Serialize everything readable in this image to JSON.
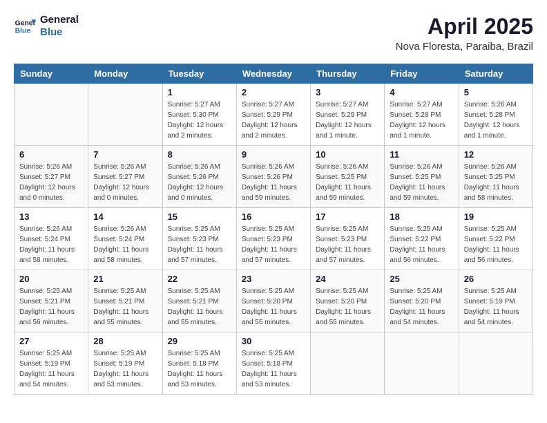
{
  "header": {
    "logo_line1": "General",
    "logo_line2": "Blue",
    "month": "April 2025",
    "location": "Nova Floresta, Paraiba, Brazil"
  },
  "weekdays": [
    "Sunday",
    "Monday",
    "Tuesday",
    "Wednesday",
    "Thursday",
    "Friday",
    "Saturday"
  ],
  "weeks": [
    [
      {
        "day": "",
        "info": ""
      },
      {
        "day": "",
        "info": ""
      },
      {
        "day": "1",
        "info": "Sunrise: 5:27 AM\nSunset: 5:30 PM\nDaylight: 12 hours\nand 2 minutes."
      },
      {
        "day": "2",
        "info": "Sunrise: 5:27 AM\nSunset: 5:29 PM\nDaylight: 12 hours\nand 2 minutes."
      },
      {
        "day": "3",
        "info": "Sunrise: 5:27 AM\nSunset: 5:29 PM\nDaylight: 12 hours\nand 1 minute."
      },
      {
        "day": "4",
        "info": "Sunrise: 5:27 AM\nSunset: 5:28 PM\nDaylight: 12 hours\nand 1 minute."
      },
      {
        "day": "5",
        "info": "Sunrise: 5:26 AM\nSunset: 5:28 PM\nDaylight: 12 hours\nand 1 minute."
      }
    ],
    [
      {
        "day": "6",
        "info": "Sunrise: 5:26 AM\nSunset: 5:27 PM\nDaylight: 12 hours\nand 0 minutes."
      },
      {
        "day": "7",
        "info": "Sunrise: 5:26 AM\nSunset: 5:27 PM\nDaylight: 12 hours\nand 0 minutes."
      },
      {
        "day": "8",
        "info": "Sunrise: 5:26 AM\nSunset: 5:26 PM\nDaylight: 12 hours\nand 0 minutes."
      },
      {
        "day": "9",
        "info": "Sunrise: 5:26 AM\nSunset: 5:26 PM\nDaylight: 11 hours\nand 59 minutes."
      },
      {
        "day": "10",
        "info": "Sunrise: 5:26 AM\nSunset: 5:25 PM\nDaylight: 11 hours\nand 59 minutes."
      },
      {
        "day": "11",
        "info": "Sunrise: 5:26 AM\nSunset: 5:25 PM\nDaylight: 11 hours\nand 59 minutes."
      },
      {
        "day": "12",
        "info": "Sunrise: 5:26 AM\nSunset: 5:25 PM\nDaylight: 11 hours\nand 58 minutes."
      }
    ],
    [
      {
        "day": "13",
        "info": "Sunrise: 5:26 AM\nSunset: 5:24 PM\nDaylight: 11 hours\nand 58 minutes."
      },
      {
        "day": "14",
        "info": "Sunrise: 5:26 AM\nSunset: 5:24 PM\nDaylight: 11 hours\nand 58 minutes."
      },
      {
        "day": "15",
        "info": "Sunrise: 5:25 AM\nSunset: 5:23 PM\nDaylight: 11 hours\nand 57 minutes."
      },
      {
        "day": "16",
        "info": "Sunrise: 5:25 AM\nSunset: 5:23 PM\nDaylight: 11 hours\nand 57 minutes."
      },
      {
        "day": "17",
        "info": "Sunrise: 5:25 AM\nSunset: 5:23 PM\nDaylight: 11 hours\nand 57 minutes."
      },
      {
        "day": "18",
        "info": "Sunrise: 5:25 AM\nSunset: 5:22 PM\nDaylight: 11 hours\nand 56 minutes."
      },
      {
        "day": "19",
        "info": "Sunrise: 5:25 AM\nSunset: 5:22 PM\nDaylight: 11 hours\nand 56 minutes."
      }
    ],
    [
      {
        "day": "20",
        "info": "Sunrise: 5:25 AM\nSunset: 5:21 PM\nDaylight: 11 hours\nand 56 minutes."
      },
      {
        "day": "21",
        "info": "Sunrise: 5:25 AM\nSunset: 5:21 PM\nDaylight: 11 hours\nand 55 minutes."
      },
      {
        "day": "22",
        "info": "Sunrise: 5:25 AM\nSunset: 5:21 PM\nDaylight: 11 hours\nand 55 minutes."
      },
      {
        "day": "23",
        "info": "Sunrise: 5:25 AM\nSunset: 5:20 PM\nDaylight: 11 hours\nand 55 minutes."
      },
      {
        "day": "24",
        "info": "Sunrise: 5:25 AM\nSunset: 5:20 PM\nDaylight: 11 hours\nand 55 minutes."
      },
      {
        "day": "25",
        "info": "Sunrise: 5:25 AM\nSunset: 5:20 PM\nDaylight: 11 hours\nand 54 minutes."
      },
      {
        "day": "26",
        "info": "Sunrise: 5:25 AM\nSunset: 5:19 PM\nDaylight: 11 hours\nand 54 minutes."
      }
    ],
    [
      {
        "day": "27",
        "info": "Sunrise: 5:25 AM\nSunset: 5:19 PM\nDaylight: 11 hours\nand 54 minutes."
      },
      {
        "day": "28",
        "info": "Sunrise: 5:25 AM\nSunset: 5:19 PM\nDaylight: 11 hours\nand 53 minutes."
      },
      {
        "day": "29",
        "info": "Sunrise: 5:25 AM\nSunset: 5:18 PM\nDaylight: 11 hours\nand 53 minutes."
      },
      {
        "day": "30",
        "info": "Sunrise: 5:25 AM\nSunset: 5:18 PM\nDaylight: 11 hours\nand 53 minutes."
      },
      {
        "day": "",
        "info": ""
      },
      {
        "day": "",
        "info": ""
      },
      {
        "day": "",
        "info": ""
      }
    ]
  ]
}
